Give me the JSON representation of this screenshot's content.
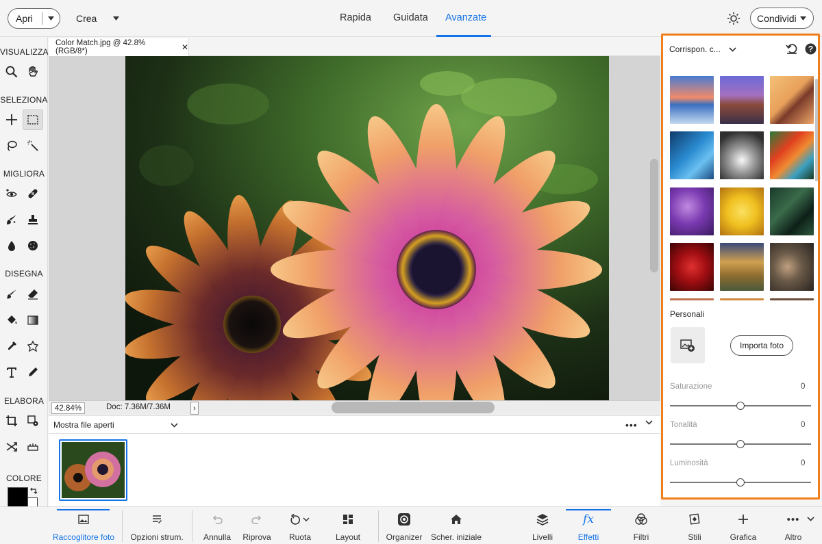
{
  "topbar": {
    "open_label": "Apri",
    "create_label": "Crea",
    "modes": [
      "Rapida",
      "Guidata",
      "Avanzate"
    ],
    "active_mode": "Avanzate",
    "share_label": "Condividi"
  },
  "toolbar": {
    "sections": {
      "view": "VISUALIZZA",
      "select": "SELEZIONA",
      "enhance": "MIGLIORA",
      "draw": "DISEGNA",
      "modify": "ELABORA",
      "color": "COLORE"
    },
    "tools": [
      "zoom-icon",
      "hand-icon",
      "move-icon",
      "marquee-icon",
      "lasso-icon",
      "magic-wand-icon",
      "red-eye-icon",
      "spot-healing-icon",
      "smart-brush-icon",
      "clone-stamp-icon",
      "blur-icon",
      "sponge-icon",
      "brush-icon",
      "eraser-icon",
      "paint-bucket-icon",
      "gradient-icon",
      "eyedropper-icon",
      "custom-shape-icon",
      "type-icon",
      "pencil-icon",
      "crop-icon",
      "recompose-icon",
      "content-aware-move-icon",
      "straighten-icon"
    ]
  },
  "document": {
    "tab_title": "Color Match.jpg @ 42.8% (RGB/8*)",
    "zoom": "42.84%",
    "doc_info": "Doc: 7.36M/7.36M"
  },
  "photo_bin": {
    "selector": "Mostra file aperti"
  },
  "panel": {
    "title": "Corrispon. c...",
    "personal_label": "Personali",
    "import_label": "Importa foto",
    "sliders": [
      {
        "label": "Saturazione",
        "value": "0",
        "position": 0.5
      },
      {
        "label": "Tonalità",
        "value": "0",
        "position": 0.5
      },
      {
        "label": "Luminosità",
        "value": "0",
        "position": 0.5
      }
    ]
  },
  "bottombar": {
    "items": [
      {
        "label": "Raccoglitore foto",
        "icon": "photo-bin-icon"
      },
      {
        "label": "Opzioni strum.",
        "icon": "tool-options-icon"
      },
      {
        "label": "Annulla",
        "icon": "undo-icon"
      },
      {
        "label": "Ripr​ova",
        "icon": "redo-icon"
      },
      {
        "label": "Ruota",
        "icon": "rotate-icon"
      },
      {
        "label": "Layout",
        "icon": "layout-icon"
      },
      {
        "label": "Organizer",
        "icon": "organizer-icon"
      },
      {
        "label": "Scher. iniziale",
        "icon": "home-icon"
      },
      {
        "label": "Livelli",
        "icon": "layers-icon"
      },
      {
        "label": "Effetti",
        "icon": "fx-icon"
      },
      {
        "label": "Filtri",
        "icon": "filters-icon"
      },
      {
        "label": "Stili",
        "icon": "styles-icon"
      },
      {
        "label": "Grafica",
        "icon": "graphics-icon"
      },
      {
        "label": "Altro",
        "icon": "more-icon"
      }
    ]
  },
  "colors": {
    "accent": "#1473e6",
    "panel_highlight": "#f07e1c",
    "foreground_swatch": "#000000",
    "background_swatch": "#ffffff"
  }
}
